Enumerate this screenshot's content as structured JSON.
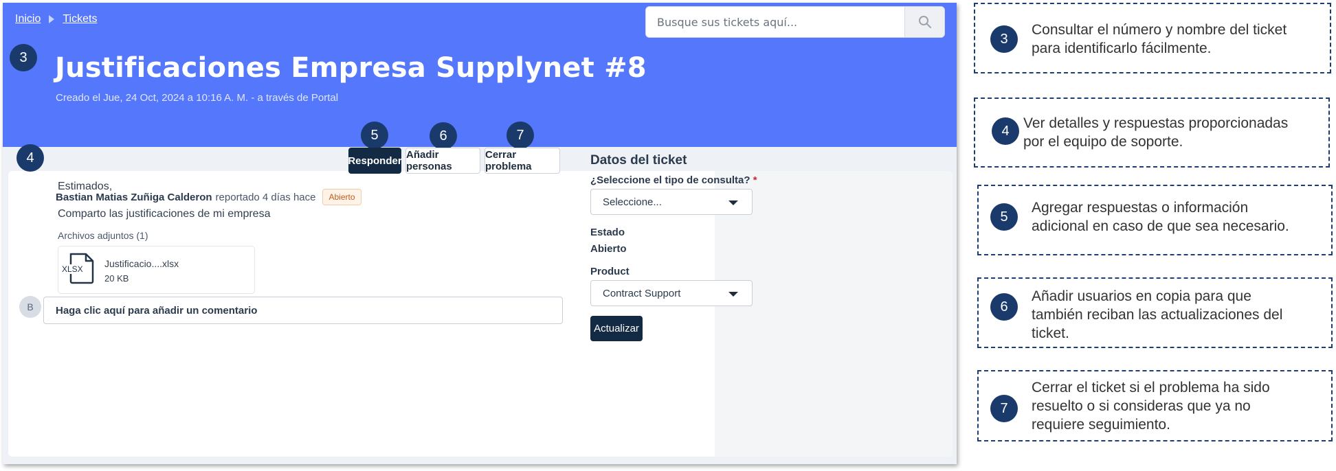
{
  "breadcrumb": {
    "home": "Inicio",
    "tickets": "Tickets"
  },
  "search": {
    "placeholder": "Busque sus tickets aquí..."
  },
  "ticket": {
    "title": "Justificaciones Empresa Supplynet #8",
    "subtitle": "Creado el Jue, 24 Oct, 2024 a 10:16 A. M. - a través de Portal"
  },
  "conversation": {
    "author": "Bastian Matias Zuñiga Calderon",
    "meta": "reportado 4 días hace",
    "status": "Abierto",
    "greeting": "Estimados,",
    "message": "Comparto las justificaciones de mi empresa",
    "attachments_label": "Archivos adjuntos (1)",
    "file_type": "XLSX",
    "file_name": "Justificacio....xlsx",
    "file_size": "20 KB",
    "avatar_initial": "B",
    "comment_placeholder": "Haga clic aquí para añadir un comentario"
  },
  "actions": {
    "reply": "Responder",
    "add_people": "Añadir personas",
    "close": "Cerrar problema"
  },
  "details": {
    "title": "Datos del ticket",
    "consult_label": "¿Seleccione el tipo de consulta?",
    "required_mark": "*",
    "consult_value": "Seleccione...",
    "state_label": "Estado",
    "state_value": "Abierto",
    "product_label": "Product",
    "product_value": "Contract Support",
    "update_button": "Actualizar"
  },
  "markers": {
    "m3": "3",
    "m4": "4",
    "m5": "5",
    "m6": "6",
    "m7": "7"
  },
  "callouts": [
    {
      "number": "3",
      "lines": [
        "Consultar el número y nombre del ticket",
        "para identificarlo fácilmente."
      ]
    },
    {
      "number": "4",
      "lines": [
        "Ver detalles y respuestas proporcionadas",
        "por el equipo de soporte."
      ]
    },
    {
      "number": "5",
      "lines": [
        "Agregar respuestas o información",
        "adicional en caso de que sea necesario."
      ]
    },
    {
      "number": "6",
      "lines": [
        "Añadir usuarios en copia para que",
        "también reciban las actualizaciones del",
        "ticket."
      ]
    },
    {
      "number": "7",
      "lines": [
        "Cerrar el ticket si el problema ha sido",
        "resuelto o si consideras que ya no",
        "requiere seguimiento."
      ]
    }
  ],
  "colors": {
    "hero": "#5577fb",
    "marker": "#1a3a6c",
    "primary_button": "#132a44",
    "status_text": "#c05c1f",
    "callout_border": "#1c3d72"
  },
  "icons": [
    "search-icon",
    "xlsx-file-icon",
    "chevron-right-icon",
    "caret-down-icon"
  ]
}
